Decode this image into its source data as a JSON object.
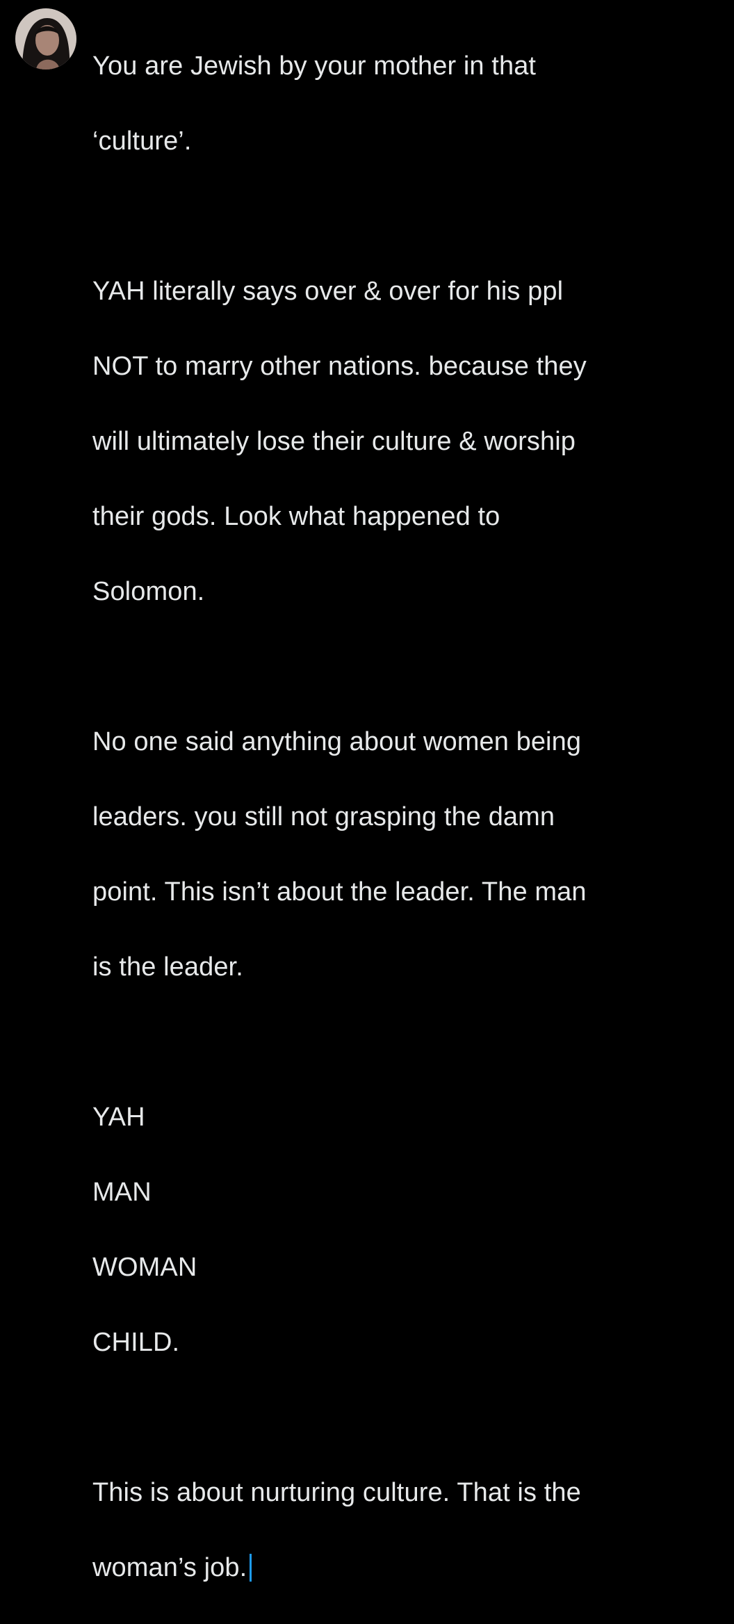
{
  "composer": {
    "avatar_alt": "profile-photo",
    "paragraphs": [
      {
        "lines": [
          "You are Jewish by your mother in that",
          "‘culture’."
        ]
      },
      {
        "lines": [
          "YAH literally says over & over for his ppl",
          "NOT to marry other nations. because they",
          "will ultimately lose their culture & worship",
          "their gods. Look what happened to",
          "Solomon."
        ]
      },
      {
        "lines": [
          "No one said anything about women being",
          "leaders. you still not grasping the damn",
          "point. This isn’t about the leader. The man",
          "is the leader."
        ]
      },
      {
        "lines": [
          "YAH",
          "MAN",
          "WOMAN",
          "CHILD."
        ]
      },
      {
        "lines": [
          "This is about nurturing culture. That is the",
          "woman’s job."
        ]
      }
    ]
  },
  "colors": {
    "background": "#000000",
    "text": "#e7e9ea",
    "caret": "#1d9bf0"
  }
}
